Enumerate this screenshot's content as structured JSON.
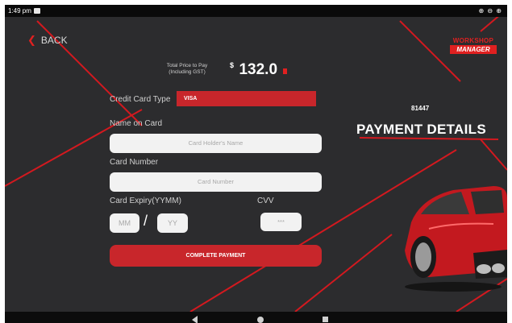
{
  "status_bar": {
    "time": "1:49 pm",
    "right_icons": "⊕ ⊖ ⊕"
  },
  "header": {
    "back_label": "BACK",
    "logo_line1": "WORKSHOP",
    "logo_line2": "MANAGER"
  },
  "summary": {
    "price_label_line1": "Total Price to Pay",
    "price_label_line2": "(Including GST)",
    "currency": "$",
    "amount": "132.0",
    "order_number": "81447",
    "title": "PAYMENT DETAILS"
  },
  "form": {
    "card_type_label": "Credit Card Type",
    "card_type_value": "VISA",
    "name_label": "Name on Card",
    "name_placeholder": "Card Holder's Name",
    "number_label": "Card Number",
    "number_placeholder": "Card Number",
    "expiry_label": "Card Expiry(YYMM)",
    "month_placeholder": "MM",
    "year_placeholder": "YY",
    "separator": "/",
    "cvv_label": "CVV",
    "cvv_placeholder": "***",
    "submit_label": "COMPLETE PAYMENT"
  },
  "colors": {
    "accent": "#c8262b",
    "background": "#2c2c2e",
    "text_light": "#d0d0d0"
  },
  "icons": [
    "chevron-left-icon",
    "notification-icon",
    "price-info-icon",
    "nav-back-icon",
    "nav-home-icon",
    "nav-recent-icon",
    "car-image"
  ]
}
